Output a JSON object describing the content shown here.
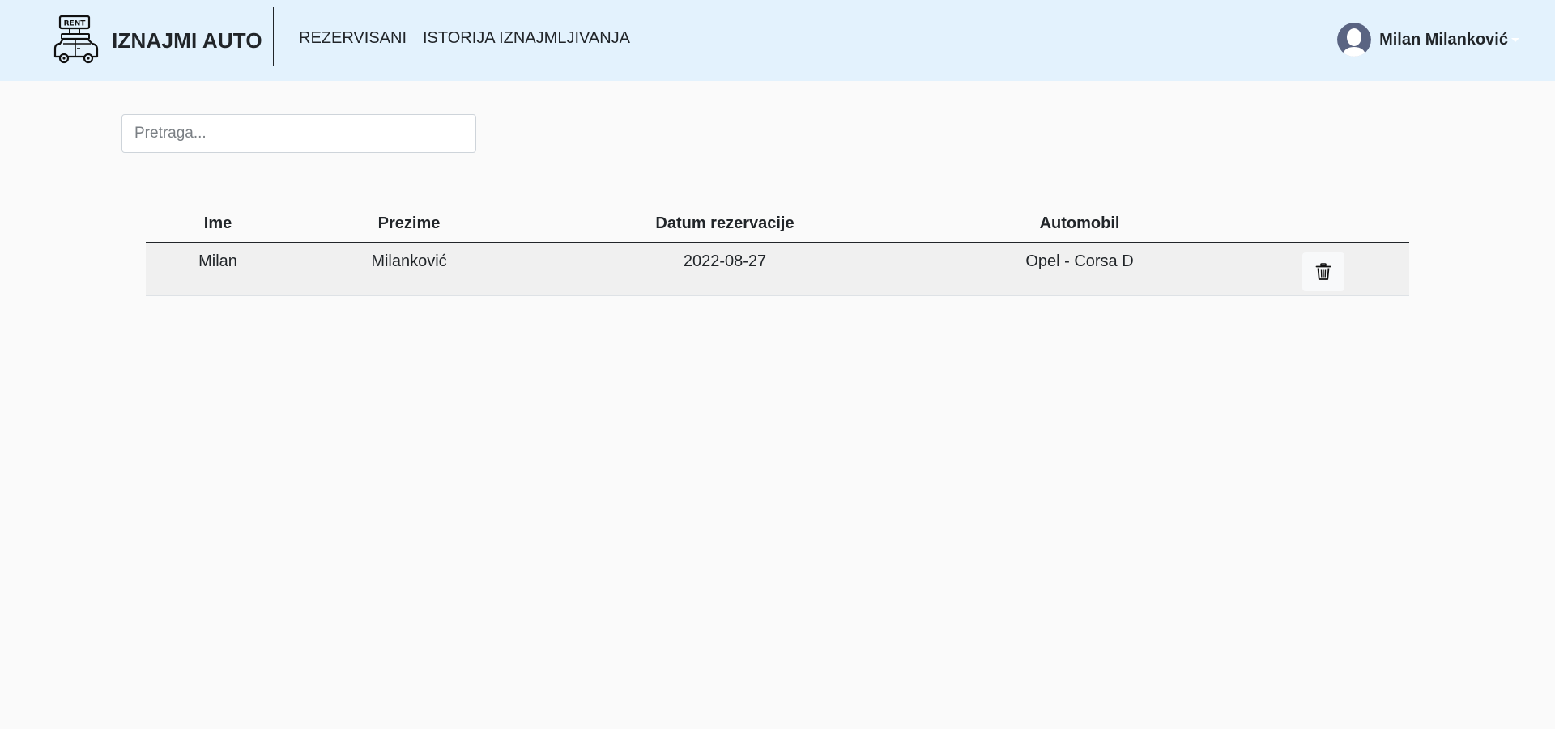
{
  "navbar": {
    "brand": "IZNAJMI AUTO",
    "logo_sign": "RENT",
    "links": [
      "REZERVISANI",
      "ISTORIJA IZNAJMLJIVANJA"
    ],
    "user_name": "Milan Milanković"
  },
  "search": {
    "placeholder": "Pretraga..."
  },
  "table": {
    "headers": [
      "Ime",
      "Prezime",
      "Datum rezervacije",
      "Automobil"
    ],
    "rows": [
      [
        "Milan",
        "Milanković",
        "2022-08-27",
        "Opel - Corsa D"
      ]
    ],
    "row_action_icon": "trash-icon"
  },
  "colors": {
    "navbar_bg": "#e3f2fd",
    "page_bg": "#fafafa",
    "row_bg": "#f0f0f0",
    "text": "#212529",
    "avatar": "#5a6482"
  }
}
